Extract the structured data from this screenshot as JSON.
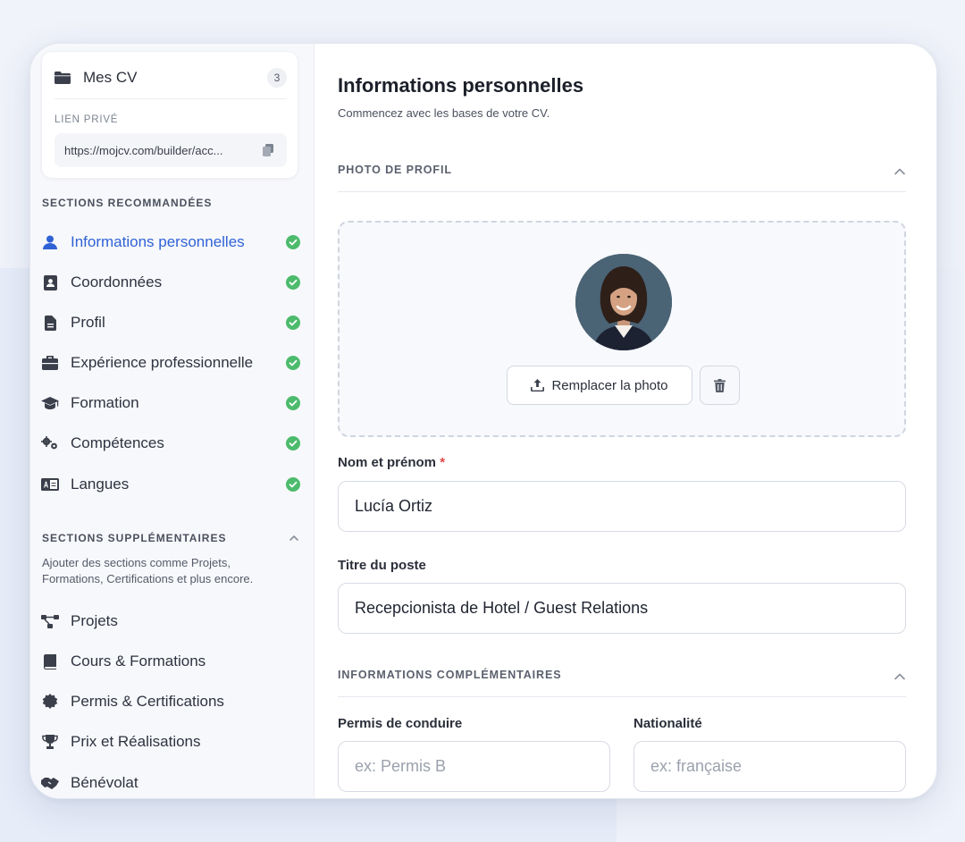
{
  "sidebar": {
    "cv_title": "Mes CV",
    "cv_count": "3",
    "lien_label": "LIEN PRIVÉ",
    "lien_url": "https://mojcv.com/builder/acc...",
    "recommended_title": "SECTIONS RECOMMANDÉES",
    "recommended": [
      {
        "label": "Informations personnelles",
        "icon": "user-icon",
        "active": true
      },
      {
        "label": "Coordonnées",
        "icon": "contact-card-icon"
      },
      {
        "label": "Profil",
        "icon": "document-icon"
      },
      {
        "label": "Expérience professionnelle",
        "icon": "briefcase-icon"
      },
      {
        "label": "Formation",
        "icon": "graduation-cap-icon"
      },
      {
        "label": "Compétences",
        "icon": "gears-icon"
      },
      {
        "label": "Langues",
        "icon": "language-icon"
      }
    ],
    "supplementary_title": "SECTIONS SUPPLÉMENTAIRES",
    "supplementary_desc": "Ajouter des sections comme Projets, Formations, Certifications et plus encore.",
    "supplementary": [
      {
        "label": "Projets",
        "icon": "project-diagram-icon"
      },
      {
        "label": "Cours & Formations",
        "icon": "book-icon"
      },
      {
        "label": "Permis & Certifications",
        "icon": "certificate-icon"
      },
      {
        "label": "Prix et Réalisations",
        "icon": "trophy-icon"
      },
      {
        "label": "Bénévolat",
        "icon": "handshake-icon"
      }
    ]
  },
  "main": {
    "title": "Informations personnelles",
    "subtitle": "Commencez avec les bases de votre CV.",
    "photo_section": "PHOTO DE PROFIL",
    "replace_photo": "Remplacer la photo",
    "name_label": "Nom et prénom",
    "required_mark": "*",
    "name_value": "Lucía Ortiz",
    "job_label": "Titre du poste",
    "job_value": "Recepcionista de Hotel / Guest Relations",
    "extra_section": "INFORMATIONS COMPLÉMENTAIRES",
    "permis_label": "Permis de conduire",
    "permis_placeholder": "ex: Permis B",
    "nationalite_label": "Nationalité",
    "nationalite_placeholder": "ex: française"
  },
  "colors": {
    "accent": "#2f62d5",
    "success": "#4cbb6c",
    "required": "#e04848"
  }
}
